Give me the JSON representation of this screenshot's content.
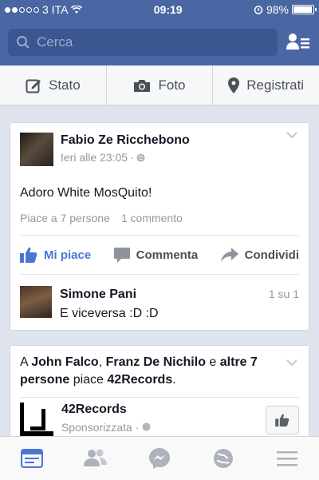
{
  "status_bar": {
    "carrier": "3 ITA",
    "time": "09:19",
    "battery": "98%",
    "battery_level": 0.98
  },
  "search": {
    "placeholder": "Cerca"
  },
  "composer": {
    "status_label": "Stato",
    "photo_label": "Foto",
    "checkin_label": "Registrati"
  },
  "post": {
    "author": "Fabio Ze Ricchebono",
    "time": "Ieri alle 23:05",
    "text": "Adoro White MosQuito!",
    "likes_text": "Piace a 7 persone",
    "comments_text": "1 commento",
    "like_label": "Mi piace",
    "comment_label": "Commenta",
    "share_label": "Condividi",
    "comment": {
      "author": "Simone Pani",
      "text": "E viceversa :D :D",
      "pagination": "1 su 1"
    }
  },
  "story": {
    "prefix": "A",
    "name1": "John Falco",
    "sep1": ",",
    "name2": "Franz De Nichilo",
    "conj": "e",
    "others": "altre 7 persone",
    "verb": "piace",
    "page": "42Records",
    "suffix": ".",
    "sponsor_name": "42Records",
    "sponsored_label": "Sponsorizzata"
  },
  "colors": {
    "brand": "#4b67a3",
    "like_blue": "#4a77d4",
    "background": "#dfe3ee"
  },
  "tabs": [
    "news-feed-icon",
    "friend-requests-icon",
    "messenger-icon",
    "notifications-icon",
    "more-menu-icon"
  ]
}
